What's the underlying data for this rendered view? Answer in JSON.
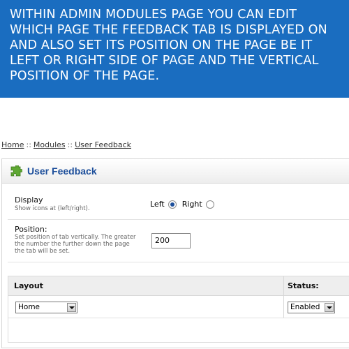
{
  "banner": {
    "text": "WITHIN ADMIN MODULES PAGE YOU CAN EDIT WHICH PAGE THE FEEDBACK TAB IS DISPLAYED ON AND ALSO SET ITS POSITION ON THE PAGE BE IT LEFT OR RIGHT SIDE OF PAGE AND THE VERTICAL POSITION OF THE PAGE."
  },
  "breadcrumb": {
    "items": [
      "Home",
      "Modules",
      "User Feedback"
    ],
    "separator": "::"
  },
  "panel": {
    "title": "User Feedback",
    "icon": "puzzle-piece-icon",
    "display": {
      "label": "Display",
      "help": "Show icons at (left/right).",
      "options": [
        {
          "label": "Left",
          "checked": true
        },
        {
          "label": "Right",
          "checked": false
        }
      ]
    },
    "position": {
      "label": "Position:",
      "help": "Set position of tab vertically. The greater the number the further down the page the tab will be set.",
      "value": "200"
    },
    "table": {
      "headers": {
        "layout": "Layout",
        "status": "Status:"
      },
      "row": {
        "layout": "Home",
        "status": "Enabled"
      }
    }
  },
  "colors": {
    "banner_bg": "#1a6dc0",
    "title": "#1d4f9b",
    "icon_green": "#5fa833"
  }
}
